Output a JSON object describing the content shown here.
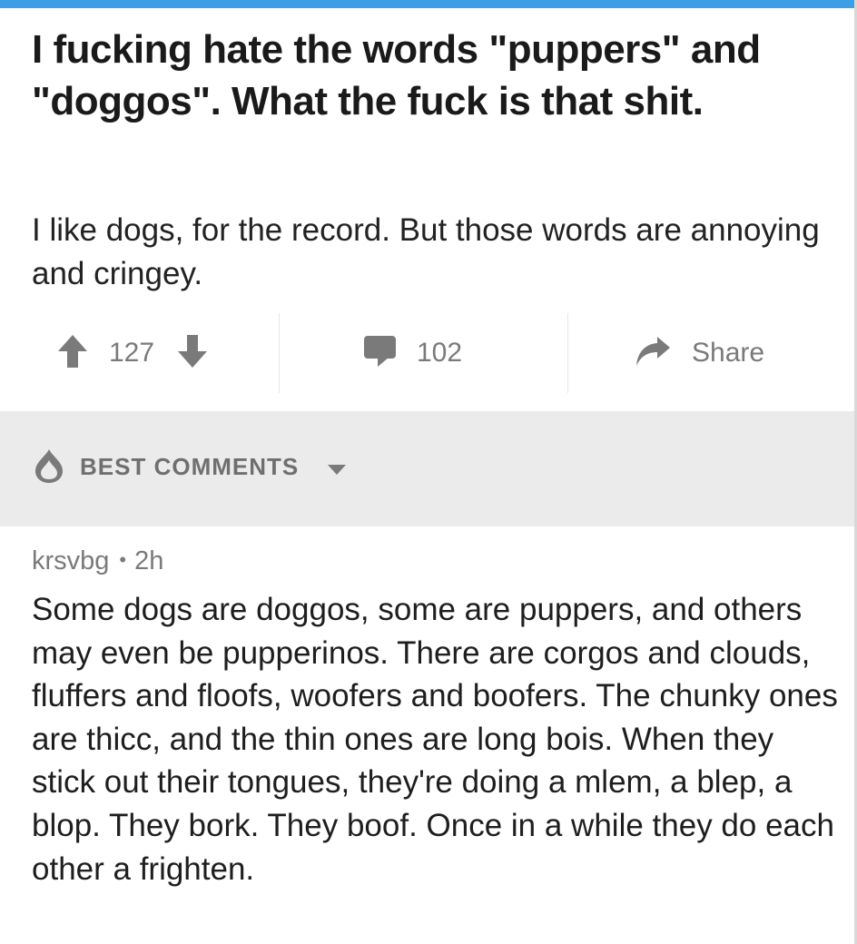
{
  "post": {
    "title": "I fucking hate the words \"puppers\" and \"doggos\". What the fuck is that shit.",
    "body": "I like dogs, for the record. But those words are annoying and cringey.",
    "score": "127",
    "comment_count": "102",
    "share_label": "Share"
  },
  "comments_section": {
    "sort_label": "BEST COMMENTS"
  },
  "comment": {
    "author": "krsvbg",
    "separator": "•",
    "age": "2h",
    "body": "Some dogs are doggos, some are puppers, and others may even be pupperinos. There are corgos and clouds, fluffers and floofs, woofers and boofers. The chunky ones are thicc, and the thin ones are long bois. When they stick out their tongues, they're doing a mlem, a blep, a blop. They bork. They boof. Once in a while they do each other a frighten."
  },
  "icons": {
    "upvote": "upvote-arrow-icon",
    "downvote": "downvote-arrow-icon",
    "comment": "comment-bubble-icon",
    "share": "share-arrow-icon",
    "sort": "flame-icon",
    "dropdown": "caret-down-icon"
  },
  "colors": {
    "accent_bar": "#3d9ee8",
    "icon_gray": "#7a7a7a",
    "section_bg": "#ebebeb"
  }
}
